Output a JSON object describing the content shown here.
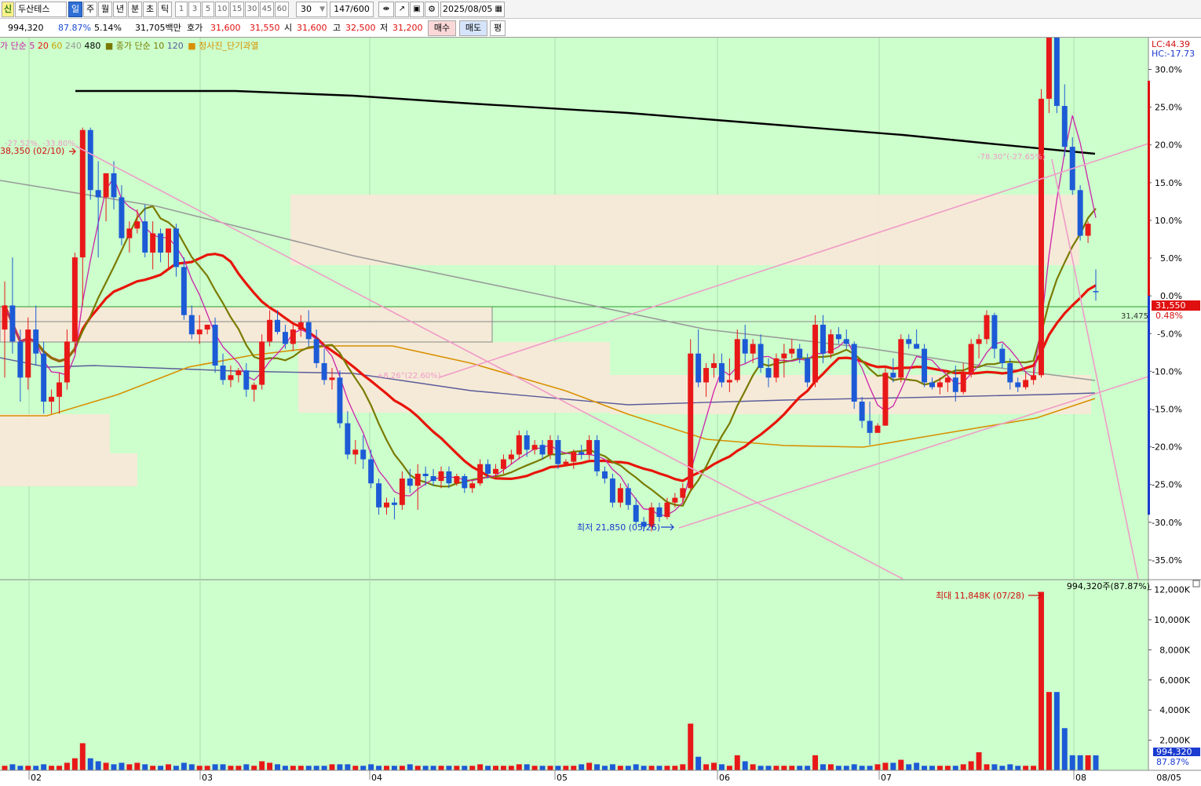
{
  "toolbar": {
    "stock_badge": "신",
    "stock_name": "두산테스",
    "periods": [
      "일",
      "주",
      "월",
      "년",
      "분",
      "초",
      "틱"
    ],
    "active_period": "일",
    "intervals": [
      "1",
      "3",
      "5",
      "10",
      "15",
      "30",
      "45",
      "60"
    ],
    "interval_value": "30",
    "count_value": "147",
    "count_total": "/600",
    "date_value": "2025/08/05"
  },
  "quote": {
    "volume": "994,320",
    "vol_ratio": "87.87%",
    "change": "5.14%",
    "amount": "31,705백만",
    "ask_label": "호가",
    "ask1": "31,600",
    "ask2": "31,550",
    "open_label": "시",
    "open": "31,600",
    "high_label": "고",
    "high": "32,500",
    "low_label": "저",
    "low": "31,200",
    "buy_button": "매수",
    "sell_button": "매도",
    "avg_button": "평"
  },
  "legend": {
    "ma_price_prefix": "가 단순",
    "ma_price_periods": [
      "5",
      "20",
      "60",
      "240",
      "480"
    ],
    "ma_price_colors": [
      "#cc22aa",
      "#e8140a",
      "#c8a000",
      "#9a9a9a",
      "#000000"
    ],
    "ma_volume_prefix": "종가 단순",
    "ma_volume_periods": [
      "10",
      "120"
    ],
    "ma_volume_colors": [
      "#7a7a00",
      "#5a5a9a"
    ],
    "indicator_label": "청사진_단기과열",
    "indicator_color": "#d89000"
  },
  "colors": {
    "up": "#e81818",
    "down": "#1c5ad6",
    "background": "#ccffcc",
    "zone": "#f8e8d8",
    "trendline": "#f09ac8"
  },
  "right_axis": {
    "lc": "LC:44.39",
    "hc": "HC:-17.73",
    "percent_ticks": [
      "30.0%",
      "25.0%",
      "20.0%",
      "15.0%",
      "10.0%",
      "5.0%",
      "0.0%",
      "-5.0%",
      "-10.0%",
      "-15.0%",
      "-20.0%",
      "-25.0%",
      "-30.0%",
      "-35.0%"
    ],
    "price_tag": "31,550",
    "price_pct": "0.48%",
    "volume_ticks": [
      "12,000K",
      "10,000K",
      "8,000K",
      "6,000K",
      "4,000K",
      "2,000K"
    ],
    "volume_tag": "994,320",
    "volume_pct": "87.87%"
  },
  "annotations": {
    "high_label": "38,350 (02/10)",
    "high_pct": "-27.52%, -33.80%",
    "low_label": "최저 21,850 (05/26)",
    "recent_high_pct": "-78.30°(-27.65%)",
    "mid_label": "+8.26°(22.60%)",
    "ma_tag": "31,475",
    "volume_max_label": "최대 11,848K (07/28)",
    "volume_current_label": "994,320주(87.87%)"
  },
  "x_axis": {
    "labels": [
      "02",
      "03",
      "04",
      "05",
      "06",
      "07",
      "08"
    ],
    "right_label": "08/05"
  },
  "chart_data": {
    "type": "candlestick",
    "date_range": [
      "2025/01/31",
      "2025/08/05"
    ],
    "candles": [
      {
        "o": 30,
        "h": 32,
        "l": 28,
        "c": 31,
        "v": 0.3
      },
      {
        "o": 31,
        "h": 33,
        "l": 29,
        "c": 29.5,
        "v": 0.4
      },
      {
        "o": 29.5,
        "h": 30,
        "l": 27,
        "c": 28,
        "v": 0.3
      },
      {
        "o": 28,
        "h": 30.5,
        "l": 27.5,
        "c": 30,
        "v": 0.3
      },
      {
        "o": 30,
        "h": 31,
        "l": 28.5,
        "c": 29,
        "v": 0.3
      },
      {
        "o": 29,
        "h": 29.5,
        "l": 26.5,
        "c": 27,
        "v": 0.4
      },
      {
        "o": 27,
        "h": 27.5,
        "l": 26.5,
        "c": 27.2,
        "v": 0.3
      },
      {
        "o": 27.2,
        "h": 28.2,
        "l": 26.5,
        "c": 27.8,
        "v": 0.3
      },
      {
        "o": 27.8,
        "h": 30,
        "l": 27.5,
        "c": 29.5,
        "v": 0.5
      },
      {
        "o": 29.5,
        "h": 33.2,
        "l": 29,
        "c": 33,
        "v": 0.8
      },
      {
        "o": 33,
        "h": 38.4,
        "l": 31,
        "c": 38.3,
        "v": 1.8
      },
      {
        "o": 38.3,
        "h": 38.4,
        "l": 35.4,
        "c": 35.8,
        "v": 0.8
      },
      {
        "o": 35.8,
        "h": 37,
        "l": 33,
        "c": 35.5,
        "v": 0.6
      },
      {
        "o": 35.5,
        "h": 36.5,
        "l": 34.5,
        "c": 36.5,
        "v": 0.5
      },
      {
        "o": 36.5,
        "h": 37,
        "l": 35,
        "c": 35.5,
        "v": 0.4
      },
      {
        "o": 35.5,
        "h": 36,
        "l": 33.5,
        "c": 33.8,
        "v": 0.5
      },
      {
        "o": 33.8,
        "h": 34.5,
        "l": 33.2,
        "c": 34.2,
        "v": 0.4
      },
      {
        "o": 34.2,
        "h": 35,
        "l": 34,
        "c": 34.5,
        "v": 0.5
      },
      {
        "o": 34.5,
        "h": 35.2,
        "l": 33,
        "c": 33.2,
        "v": 0.4
      },
      {
        "o": 33.2,
        "h": 34.5,
        "l": 32.5,
        "c": 34,
        "v": 0.3
      },
      {
        "o": 34,
        "h": 34.2,
        "l": 32.8,
        "c": 33.2,
        "v": 0.3
      },
      {
        "o": 33.2,
        "h": 34.2,
        "l": 32.5,
        "c": 34.2,
        "v": 0.4
      },
      {
        "o": 34.2,
        "h": 34.4,
        "l": 32.2,
        "c": 32.6,
        "v": 0.3
      },
      {
        "o": 32.6,
        "h": 33,
        "l": 30.4,
        "c": 30.6,
        "v": 0.5
      },
      {
        "o": 30.6,
        "h": 31,
        "l": 29.6,
        "c": 29.8,
        "v": 0.4
      },
      {
        "o": 29.8,
        "h": 30.6,
        "l": 29.4,
        "c": 30,
        "v": 0.3
      },
      {
        "o": 30,
        "h": 30.2,
        "l": 29.8,
        "c": 30.2,
        "v": 0.3
      },
      {
        "o": 30.2,
        "h": 30.5,
        "l": 28.2,
        "c": 28.5,
        "v": 0.4
      },
      {
        "o": 28.5,
        "h": 29,
        "l": 27.7,
        "c": 27.9,
        "v": 0.4
      },
      {
        "o": 27.9,
        "h": 28.5,
        "l": 27.6,
        "c": 28.1,
        "v": 0.3
      },
      {
        "o": 28.1,
        "h": 28.4,
        "l": 27.8,
        "c": 28.3,
        "v": 0.3
      },
      {
        "o": 28.3,
        "h": 28.6,
        "l": 27.2,
        "c": 27.5,
        "v": 0.4
      },
      {
        "o": 27.5,
        "h": 27.8,
        "l": 27,
        "c": 27.7,
        "v": 0.3
      },
      {
        "o": 27.7,
        "h": 29.8,
        "l": 27.5,
        "c": 29.5,
        "v": 0.6
      },
      {
        "o": 29.5,
        "h": 30.8,
        "l": 29.3,
        "c": 30.4,
        "v": 0.5
      },
      {
        "o": 30.4,
        "h": 30.8,
        "l": 29.8,
        "c": 29.9,
        "v": 0.4
      },
      {
        "o": 29.9,
        "h": 30.2,
        "l": 29.2,
        "c": 29.4,
        "v": 0.3
      },
      {
        "o": 29.4,
        "h": 30.2,
        "l": 29.1,
        "c": 30.0,
        "v": 0.3
      },
      {
        "o": 30.0,
        "h": 30.6,
        "l": 29.7,
        "c": 30.3,
        "v": 0.3
      },
      {
        "o": 30.3,
        "h": 30.8,
        "l": 29.3,
        "c": 29.6,
        "v": 0.3
      },
      {
        "o": 29.6,
        "h": 30.0,
        "l": 28.4,
        "c": 28.6,
        "v": 0.3
      },
      {
        "o": 28.6,
        "h": 29.2,
        "l": 27.7,
        "c": 27.9,
        "v": 0.3
      },
      {
        "o": 27.9,
        "h": 28.4,
        "l": 27.5,
        "c": 28.0,
        "v": 0.4
      },
      {
        "o": 28.0,
        "h": 28.3,
        "l": 25.9,
        "c": 26.1,
        "v": 0.4
      },
      {
        "o": 26.1,
        "h": 26.6,
        "l": 24.6,
        "c": 24.8,
        "v": 0.4
      },
      {
        "o": 24.8,
        "h": 25.4,
        "l": 24.4,
        "c": 25.0,
        "v": 0.3
      },
      {
        "o": 25.0,
        "h": 25.6,
        "l": 24.2,
        "c": 24.6,
        "v": 0.3
      },
      {
        "o": 24.6,
        "h": 25.0,
        "l": 23.4,
        "c": 23.6,
        "v": 0.4
      },
      {
        "o": 23.6,
        "h": 23.8,
        "l": 22.3,
        "c": 22.6,
        "v": 0.3
      },
      {
        "o": 22.6,
        "h": 23.0,
        "l": 22.3,
        "c": 22.8,
        "v": 0.3
      },
      {
        "o": 22.8,
        "h": 23.0,
        "l": 22.1,
        "c": 22.7,
        "v": 0.3
      },
      {
        "o": 22.7,
        "h": 24.1,
        "l": 22.5,
        "c": 23.8,
        "v": 0.3
      },
      {
        "o": 23.8,
        "h": 24.2,
        "l": 23.2,
        "c": 23.5,
        "v": 0.4
      },
      {
        "o": 23.5,
        "h": 24.4,
        "l": 22.5,
        "c": 24.0,
        "v": 0.3
      },
      {
        "o": 24.0,
        "h": 24.3,
        "l": 23.5,
        "c": 23.9,
        "v": 0.3
      },
      {
        "o": 23.9,
        "h": 24.2,
        "l": 23.5,
        "c": 23.7,
        "v": 0.3
      },
      {
        "o": 23.7,
        "h": 24.3,
        "l": 23.4,
        "c": 24.1,
        "v": 0.3
      },
      {
        "o": 24.1,
        "h": 24.3,
        "l": 23.4,
        "c": 23.6,
        "v": 0.3
      },
      {
        "o": 23.6,
        "h": 24.0,
        "l": 23.5,
        "c": 23.9,
        "v": 0.3
      },
      {
        "o": 23.9,
        "h": 24.0,
        "l": 23.2,
        "c": 23.4,
        "v": 0.3
      },
      {
        "o": 23.4,
        "h": 23.7,
        "l": 23.2,
        "c": 23.6,
        "v": 0.3
      },
      {
        "o": 23.6,
        "h": 24.6,
        "l": 23.5,
        "c": 24.4,
        "v": 0.4
      },
      {
        "o": 24.4,
        "h": 24.6,
        "l": 23.8,
        "c": 24.0,
        "v": 0.3
      },
      {
        "o": 24.0,
        "h": 24.4,
        "l": 23.9,
        "c": 24.2,
        "v": 0.3
      },
      {
        "o": 24.2,
        "h": 24.8,
        "l": 24.0,
        "c": 24.6,
        "v": 0.3
      },
      {
        "o": 24.6,
        "h": 25.0,
        "l": 24.4,
        "c": 24.8,
        "v": 0.3
      },
      {
        "o": 24.8,
        "h": 25.8,
        "l": 24.6,
        "c": 25.6,
        "v": 0.4
      },
      {
        "o": 25.6,
        "h": 25.8,
        "l": 24.7,
        "c": 25.0,
        "v": 0.4
      },
      {
        "o": 25.0,
        "h": 25.4,
        "l": 24.8,
        "c": 25.2,
        "v": 0.3
      },
      {
        "o": 25.2,
        "h": 25.4,
        "l": 24.6,
        "c": 24.8,
        "v": 0.3
      },
      {
        "o": 24.8,
        "h": 25.6,
        "l": 24.6,
        "c": 25.4,
        "v": 0.3
      },
      {
        "o": 25.4,
        "h": 25.6,
        "l": 24.2,
        "c": 24.4,
        "v": 0.3
      },
      {
        "o": 24.4,
        "h": 24.6,
        "l": 24.3,
        "c": 24.5,
        "v": 0.3
      },
      {
        "o": 24.5,
        "h": 25.0,
        "l": 24.2,
        "c": 24.9,
        "v": 0.3
      },
      {
        "o": 24.9,
        "h": 25.2,
        "l": 24.6,
        "c": 24.8,
        "v": 0.4
      },
      {
        "o": 24.8,
        "h": 25.6,
        "l": 24.6,
        "c": 25.4,
        "v": 0.5
      },
      {
        "o": 25.4,
        "h": 25.6,
        "l": 23.9,
        "c": 24.1,
        "v": 0.4
      },
      {
        "o": 24.1,
        "h": 24.3,
        "l": 23.6,
        "c": 23.8,
        "v": 0.3
      },
      {
        "o": 23.8,
        "h": 24.0,
        "l": 22.6,
        "c": 22.8,
        "v": 0.4
      },
      {
        "o": 22.8,
        "h": 23.6,
        "l": 22.6,
        "c": 23.4,
        "v": 0.3
      },
      {
        "o": 23.4,
        "h": 23.6,
        "l": 22.5,
        "c": 22.7,
        "v": 0.3
      },
      {
        "o": 22.7,
        "h": 23.0,
        "l": 21.9,
        "c": 22.0,
        "v": 0.4
      },
      {
        "o": 22.0,
        "h": 22.2,
        "l": 21.6,
        "c": 21.8,
        "v": 0.3
      },
      {
        "o": 21.8,
        "h": 22.8,
        "l": 21.6,
        "c": 22.6,
        "v": 0.3
      },
      {
        "o": 22.6,
        "h": 22.8,
        "l": 22.0,
        "c": 22.2,
        "v": 0.3
      },
      {
        "o": 22.2,
        "h": 23.0,
        "l": 22.1,
        "c": 22.8,
        "v": 0.3
      },
      {
        "o": 22.8,
        "h": 23.2,
        "l": 22.6,
        "c": 23.0,
        "v": 0.3
      },
      {
        "o": 23.0,
        "h": 23.6,
        "l": 22.8,
        "c": 23.4,
        "v": 0.4
      },
      {
        "o": 23.4,
        "h": 29.6,
        "l": 23.3,
        "c": 29.0,
        "v": 3.1
      },
      {
        "o": 29.0,
        "h": 30.0,
        "l": 27.6,
        "c": 27.8,
        "v": 0.9
      },
      {
        "o": 27.8,
        "h": 28.6,
        "l": 27.2,
        "c": 28.4,
        "v": 0.4
      },
      {
        "o": 28.4,
        "h": 29.0,
        "l": 28.0,
        "c": 28.6,
        "v": 0.5
      },
      {
        "o": 28.6,
        "h": 29.0,
        "l": 27.6,
        "c": 27.8,
        "v": 0.4
      },
      {
        "o": 27.8,
        "h": 28.8,
        "l": 27.4,
        "c": 27.9,
        "v": 0.3
      },
      {
        "o": 27.9,
        "h": 30.0,
        "l": 27.8,
        "c": 29.6,
        "v": 1.0
      },
      {
        "o": 29.6,
        "h": 30.2,
        "l": 28.6,
        "c": 29.0,
        "v": 0.6
      },
      {
        "o": 29.0,
        "h": 29.6,
        "l": 28.6,
        "c": 29.4,
        "v": 0.4
      },
      {
        "o": 29.4,
        "h": 29.8,
        "l": 28.2,
        "c": 28.4,
        "v": 0.3
      },
      {
        "o": 28.4,
        "h": 28.8,
        "l": 27.6,
        "c": 28.0,
        "v": 0.3
      },
      {
        "o": 28.0,
        "h": 29.0,
        "l": 27.8,
        "c": 28.8,
        "v": 0.3
      },
      {
        "o": 28.8,
        "h": 29.4,
        "l": 28.0,
        "c": 29.0,
        "v": 0.3
      },
      {
        "o": 29.0,
        "h": 29.6,
        "l": 28.8,
        "c": 29.2,
        "v": 0.3
      },
      {
        "o": 29.2,
        "h": 29.4,
        "l": 28.6,
        "c": 28.8,
        "v": 0.3
      },
      {
        "o": 28.8,
        "h": 29.0,
        "l": 27.6,
        "c": 27.8,
        "v": 0.3
      },
      {
        "o": 27.8,
        "h": 30.6,
        "l": 27.6,
        "c": 30.2,
        "v": 1.0
      },
      {
        "o": 30.2,
        "h": 30.6,
        "l": 28.6,
        "c": 29.0,
        "v": 0.4
      },
      {
        "o": 29.0,
        "h": 30.0,
        "l": 28.8,
        "c": 29.8,
        "v": 0.4
      },
      {
        "o": 29.8,
        "h": 30.1,
        "l": 29.4,
        "c": 29.6,
        "v": 0.3
      },
      {
        "o": 29.6,
        "h": 30.0,
        "l": 29.2,
        "c": 29.4,
        "v": 0.3
      },
      {
        "o": 29.4,
        "h": 29.5,
        "l": 26.7,
        "c": 27.0,
        "v": 0.4
      },
      {
        "o": 27.0,
        "h": 27.2,
        "l": 25.9,
        "c": 26.2,
        "v": 0.3
      },
      {
        "o": 26.2,
        "h": 27.0,
        "l": 25.2,
        "c": 25.7,
        "v": 0.3
      },
      {
        "o": 25.7,
        "h": 26.1,
        "l": 25.8,
        "c": 26.0,
        "v": 0.4
      },
      {
        "o": 26.0,
        "h": 28.4,
        "l": 26.0,
        "c": 28.2,
        "v": 0.5
      },
      {
        "o": 28.2,
        "h": 28.8,
        "l": 27.8,
        "c": 28.0,
        "v": 0.5
      },
      {
        "o": 28.0,
        "h": 29.8,
        "l": 27.8,
        "c": 29.6,
        "v": 0.7
      },
      {
        "o": 29.6,
        "h": 29.8,
        "l": 29.2,
        "c": 29.4,
        "v": 0.4
      },
      {
        "o": 29.4,
        "h": 30.0,
        "l": 29.2,
        "c": 29.2,
        "v": 0.5
      },
      {
        "o": 29.2,
        "h": 29.4,
        "l": 27.6,
        "c": 27.8,
        "v": 0.3
      },
      {
        "o": 27.8,
        "h": 28.0,
        "l": 27.5,
        "c": 27.6,
        "v": 0.3
      },
      {
        "o": 27.6,
        "h": 28.0,
        "l": 27.3,
        "c": 27.8,
        "v": 0.3
      },
      {
        "o": 27.8,
        "h": 28.1,
        "l": 27.4,
        "c": 28.0,
        "v": 0.3
      },
      {
        "o": 28.0,
        "h": 28.5,
        "l": 27.0,
        "c": 27.4,
        "v": 0.3
      },
      {
        "o": 27.4,
        "h": 28.6,
        "l": 27.3,
        "c": 28.2,
        "v": 0.4
      },
      {
        "o": 28.2,
        "h": 29.6,
        "l": 28.0,
        "c": 29.4,
        "v": 0.6
      },
      {
        "o": 29.4,
        "h": 29.8,
        "l": 28.8,
        "c": 29.6,
        "v": 1.2
      },
      {
        "o": 29.6,
        "h": 30.8,
        "l": 29.4,
        "c": 30.6,
        "v": 0.4
      },
      {
        "o": 30.6,
        "h": 30.7,
        "l": 28.8,
        "c": 29.2,
        "v": 0.4
      },
      {
        "o": 29.2,
        "h": 29.4,
        "l": 28.4,
        "c": 28.6,
        "v": 0.3
      },
      {
        "o": 28.6,
        "h": 28.8,
        "l": 27.5,
        "c": 27.8,
        "v": 0.4
      },
      {
        "o": 27.8,
        "h": 28.0,
        "l": 27.4,
        "c": 27.6,
        "v": 0.3
      },
      {
        "o": 27.6,
        "h": 28.2,
        "l": 27.5,
        "c": 27.9,
        "v": 0.3
      },
      {
        "o": 27.9,
        "h": 28.6,
        "l": 27.7,
        "c": 28.1,
        "v": 0.3
      },
      {
        "o": 28.1,
        "h": 40.0,
        "l": 28.0,
        "c": 39.6,
        "v": 11.848
      },
      {
        "o": 39.6,
        "h": 43.5,
        "l": 39.0,
        "c": 42.2,
        "v": 5.2
      },
      {
        "o": 42.2,
        "h": 43.6,
        "l": 39.0,
        "c": 39.3,
        "v": 5.2
      },
      {
        "o": 39.3,
        "h": 40.2,
        "l": 37.2,
        "c": 37.6,
        "v": 2.8
      },
      {
        "o": 37.6,
        "h": 38.0,
        "l": 35.6,
        "c": 35.8,
        "v": 1.0
      },
      {
        "o": 35.8,
        "h": 36.0,
        "l": 33.7,
        "c": 33.9,
        "v": 1.0
      },
      {
        "o": 33.9,
        "h": 34.5,
        "l": 33.6,
        "c": 34.4,
        "v": 1.0
      },
      {
        "o": 31.6,
        "h": 32.5,
        "l": 31.2,
        "c": 31.55,
        "v": 0.994
      }
    ]
  }
}
